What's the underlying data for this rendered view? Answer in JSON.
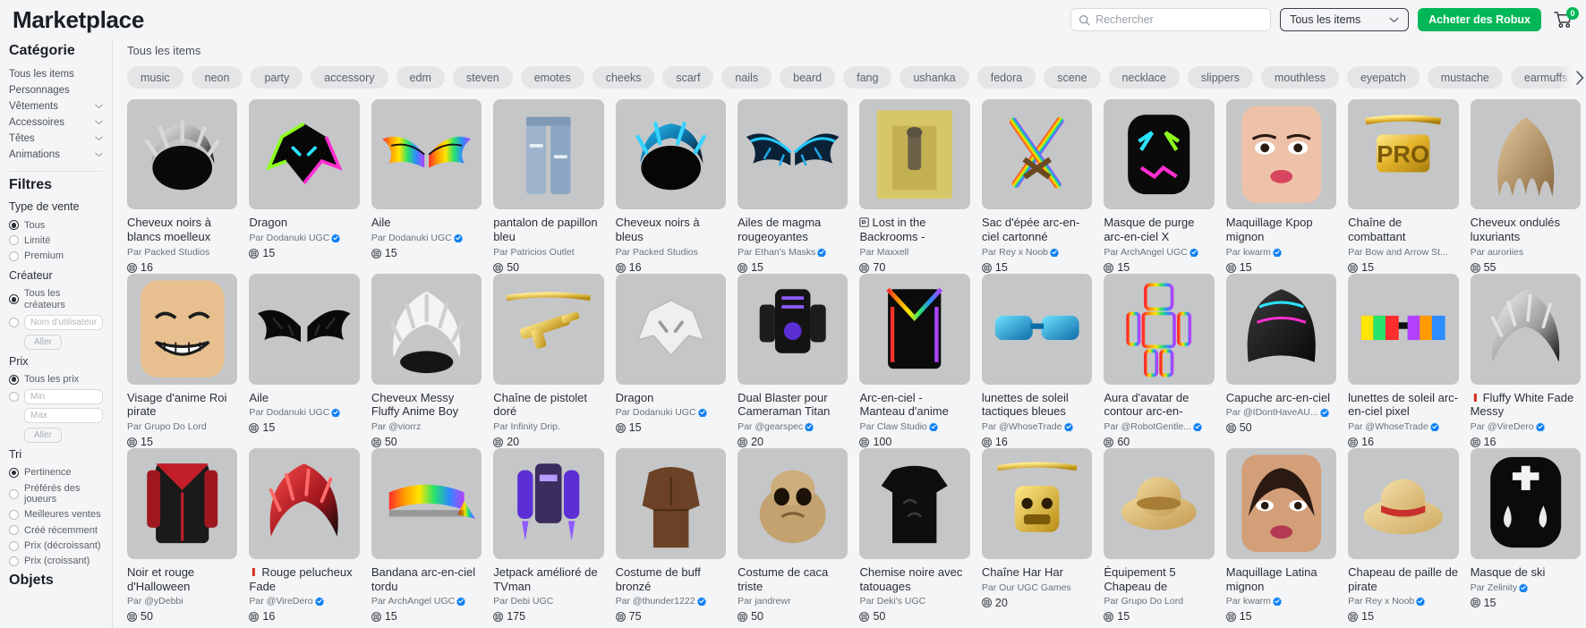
{
  "header": {
    "brand": "Marketplace",
    "search": {
      "placeholder": "Rechercher",
      "value": "",
      "icon": "search-icon"
    },
    "filter_select": {
      "label": "Tous les items",
      "icon": "chevron-down-icon"
    },
    "buy_robux_label": "Acheter des Robux",
    "cart": {
      "icon": "cart-icon",
      "badge": "0"
    },
    "accent_green": "#02b757",
    "verified_blue": "#0d7ff5"
  },
  "sidebar": {
    "category_heading": "Catégorie",
    "category_items": [
      {
        "label": "Tous les items",
        "expandable": false
      },
      {
        "label": "Personnages",
        "expandable": false
      },
      {
        "label": "Vêtements",
        "expandable": true
      },
      {
        "label": "Accessoires",
        "expandable": true
      },
      {
        "label": "Têtes",
        "expandable": true
      },
      {
        "label": "Animations",
        "expandable": true
      }
    ],
    "filters_heading": "Filtres",
    "sale_type": {
      "heading": "Type de vente",
      "options": [
        {
          "label": "Tous",
          "selected": true
        },
        {
          "label": "Limité",
          "selected": false
        },
        {
          "label": "Premium",
          "selected": false
        }
      ]
    },
    "creator": {
      "heading": "Créateur",
      "options": [
        {
          "label": "Tous les créateurs",
          "selected": true
        }
      ],
      "username_placeholder": "Nom d'utilisateur",
      "username_value": "",
      "go_label": "Aller"
    },
    "price": {
      "heading": "Prix",
      "options": [
        {
          "label": "Tous les prix",
          "selected": true
        }
      ],
      "min_placeholder": "Min",
      "min_value": "",
      "max_placeholder": "Max",
      "max_value": "",
      "go_label": "Aller"
    },
    "sort": {
      "heading": "Tri",
      "options": [
        {
          "label": "Pertinence",
          "selected": true
        },
        {
          "label": "Préférés des joueurs",
          "selected": false
        },
        {
          "label": "Meilleures ventes",
          "selected": false
        },
        {
          "label": "Créé récemment",
          "selected": false
        },
        {
          "label": "Prix (décroissant)",
          "selected": false
        },
        {
          "label": "Prix (croissant)",
          "selected": false
        }
      ]
    },
    "objects_heading": "Objets"
  },
  "main": {
    "title": "Tous les items",
    "chips": [
      "music",
      "neon",
      "party",
      "accessory",
      "edm",
      "steven",
      "emotes",
      "cheeks",
      "scarf",
      "nails",
      "beard",
      "fang",
      "ushanka",
      "fedora",
      "scene",
      "necklace",
      "slippers",
      "mouthless",
      "eyepatch",
      "mustache",
      "earmuffs"
    ],
    "chips_next_icon": "chevron-right-icon",
    "items": [
      {
        "title": "Cheveux noirs à blancs moelleux",
        "creator": "Par Packed Studios",
        "verified": false,
        "price": "16",
        "art": "hair-black-white"
      },
      {
        "title": "Dragon",
        "creator": "Par Dodanuki UGC",
        "verified": true,
        "price": "15",
        "art": "dragon-green"
      },
      {
        "title": "Aile",
        "creator": "Par Dodanuki UGC",
        "verified": true,
        "price": "15",
        "art": "wings-rainbow"
      },
      {
        "title": "pantalon de papillon bleu",
        "creator": "Par Patricios Outlet",
        "verified": false,
        "price": "50",
        "art": "jeans-blue"
      },
      {
        "title": "Cheveux noirs à bleus",
        "creator": "Par Packed Studios",
        "verified": false,
        "price": "16",
        "art": "hair-black-blue"
      },
      {
        "title": "Ailes de magma rougeoyantes",
        "creator": "Par Ethan's Masks",
        "verified": true,
        "price": "15",
        "art": "wings-magma"
      },
      {
        "title": "Lost in the Backrooms -",
        "creator": "Par Maxxell",
        "verified": false,
        "price": "70",
        "art": "backrooms",
        "title_icon": "game-pass-icon"
      },
      {
        "title": "Sac d'épée arc-en-ciel cartonné",
        "creator": "Par Rey x Noob",
        "verified": true,
        "price": "15",
        "art": "swords-rainbow"
      },
      {
        "title": "Masque de purge arc-en-ciel X",
        "creator": "Par ArchAngel UGC",
        "verified": true,
        "price": "15",
        "art": "purge-mask"
      },
      {
        "title": "Maquillage Kpop mignon",
        "creator": "Par kwarm",
        "verified": true,
        "price": "15",
        "art": "kpop-makeup"
      },
      {
        "title": "Chaîne de combattant",
        "creator": "Par Bow and Arrow St...",
        "verified": false,
        "price": "15",
        "art": "pro-chain"
      },
      {
        "title": "Cheveux ondulés luxuriants",
        "creator": "Par auroriies",
        "verified": false,
        "price": "55",
        "art": "hair-wavy-blonde"
      },
      {
        "title": "Visage d'anime Roi pirate",
        "creator": "Par Grupo Do Lord",
        "verified": false,
        "price": "15",
        "art": "anime-face"
      },
      {
        "title": "Aile",
        "creator": "Par Dodanuki UGC",
        "verified": true,
        "price": "15",
        "art": "wings-black"
      },
      {
        "title": "Cheveux Messy Fluffy Anime Boy",
        "creator": "Par @viorrz",
        "verified": false,
        "price": "50",
        "art": "hair-white-fluffy"
      },
      {
        "title": "Chaîne de pistolet doré",
        "creator": "Par Infinity Drip.",
        "verified": false,
        "price": "20",
        "art": "gold-gun-chain"
      },
      {
        "title": "Dragon",
        "creator": "Par Dodanuki UGC",
        "verified": true,
        "price": "15",
        "art": "dragon-white"
      },
      {
        "title": "Dual Blaster pour Cameraman Titan",
        "creator": "Par @gearspec",
        "verified": true,
        "price": "20",
        "art": "dual-blaster"
      },
      {
        "title": "Arc-en-ciel - Manteau d'anime",
        "creator": "Par Claw Studio",
        "verified": true,
        "price": "100",
        "art": "rainbow-coat"
      },
      {
        "title": "lunettes de soleil tactiques bleues",
        "creator": "Par @WhoseTrade",
        "verified": true,
        "price": "16",
        "art": "sunglasses-blue"
      },
      {
        "title": "Aura d'avatar de contour arc-en-",
        "creator": "Par @RobotGentle...",
        "verified": true,
        "price": "60",
        "art": "avatar-aura"
      },
      {
        "title": "Capuche arc-en-ciel",
        "creator": "Par @IDontHaveAU...",
        "verified": true,
        "price": "50",
        "art": "rainbow-hood"
      },
      {
        "title": "lunettes de soleil arc-en-ciel pixel",
        "creator": "Par @WhoseTrade",
        "verified": true,
        "price": "16",
        "art": "pixel-sunglasses"
      },
      {
        "title": "Fluffy White Fade Messy",
        "creator": "Par @VireDero",
        "verified": true,
        "price": "16",
        "art": "hair-white-fade",
        "title_icon": "red-bar-icon"
      },
      {
        "title": "Noir et rouge d'Halloween",
        "creator": "Par @yDebbi",
        "verified": false,
        "price": "50",
        "art": "halloween-jacket"
      },
      {
        "title": "Rouge pelucheux Fade",
        "creator": "Par @VireDero",
        "verified": true,
        "price": "16",
        "art": "hair-red-fluffy",
        "title_icon": "red-bar-icon"
      },
      {
        "title": "Bandana arc-en-ciel tordu",
        "creator": "Par ArchAngel UGC",
        "verified": true,
        "price": "15",
        "art": "rainbow-bandana"
      },
      {
        "title": "Jetpack amélioré de TVman",
        "creator": "Par Debi UGC",
        "verified": false,
        "price": "175",
        "art": "jetpack"
      },
      {
        "title": "Costume de buff bronzé",
        "creator": "Par @thunder1222",
        "verified": true,
        "price": "75",
        "art": "buff-costume"
      },
      {
        "title": "Costume de caca triste",
        "creator": "Par jandrewr",
        "verified": false,
        "price": "50",
        "art": "poop-costume"
      },
      {
        "title": "Chemise noire avec tatouages",
        "creator": "Par Deki's UGC",
        "verified": false,
        "price": "50",
        "art": "black-shirt"
      },
      {
        "title": "Chaîne Har Har",
        "creator": "Par Our UGC Games",
        "verified": false,
        "price": "20",
        "art": "freddy-chain"
      },
      {
        "title": "Équipement 5 Chapeau de",
        "creator": "Par Grupo Do Lord",
        "verified": false,
        "price": "15",
        "art": "gear-hat"
      },
      {
        "title": "Maquillage Latina mignon",
        "creator": "Par kwarm",
        "verified": true,
        "price": "15",
        "art": "latina-makeup"
      },
      {
        "title": "Chapeau de paille de pirate",
        "creator": "Par Rey x Noob",
        "verified": true,
        "price": "15",
        "art": "straw-hat"
      },
      {
        "title": "Masque de ski",
        "creator": "Par Zelinity",
        "verified": true,
        "price": "15",
        "art": "ski-mask"
      }
    ]
  }
}
